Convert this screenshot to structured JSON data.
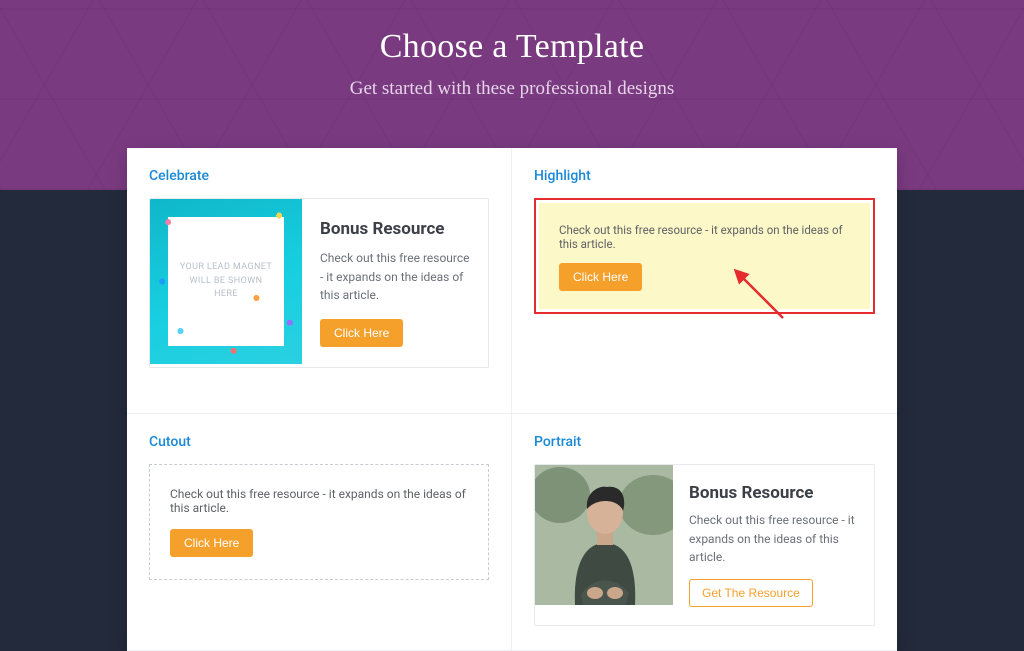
{
  "hero": {
    "title": "Choose a Template",
    "subtitle": "Get started with these professional designs"
  },
  "templates": {
    "celebrate": {
      "label": "Celebrate",
      "thumb_placeholder": "YOUR LEAD MAGNET WILL BE SHOWN HERE",
      "heading": "Bonus Resource",
      "description": "Check out this free resource - it expands on the ideas of this article.",
      "button": "Click Here"
    },
    "highlight": {
      "label": "Highlight",
      "description": "Check out this free resource - it expands on the ideas of this article.",
      "button": "Click Here"
    },
    "cutout": {
      "label": "Cutout",
      "description": "Check out this free resource - it expands on the ideas of this article.",
      "button": "Click Here"
    },
    "portrait": {
      "label": "Portrait",
      "heading": "Bonus Resource",
      "description": "Check out this free resource - it expands on the ideas of this article.",
      "button": "Get The Resource"
    }
  },
  "annotation": {
    "arrow_color": "#e52b2b",
    "highlight_border": "#e52b2b"
  }
}
